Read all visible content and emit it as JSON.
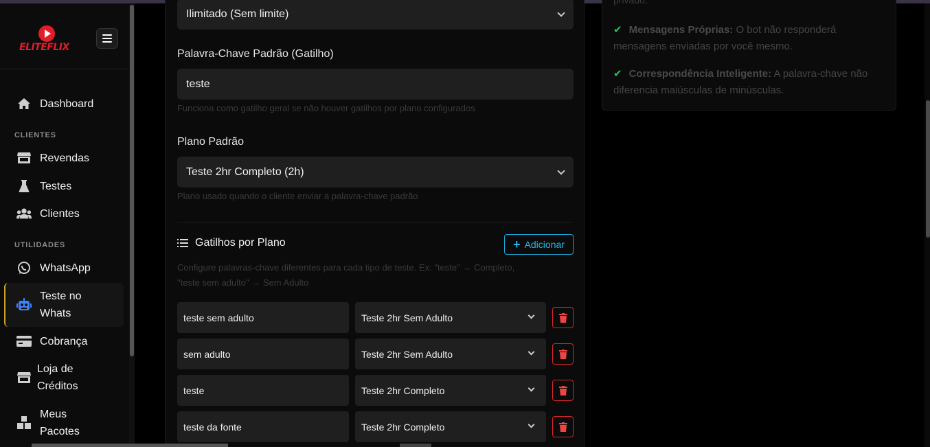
{
  "sidebar": {
    "logo_text": "ELITEFLIX",
    "sections": [
      "CLIENTES",
      "UTILIDADES"
    ],
    "items": [
      {
        "label": "Dashboard",
        "icon": "home-icon"
      },
      {
        "label": "Revendas",
        "icon": "store-icon"
      },
      {
        "label": "Testes",
        "icon": "flask-icon"
      },
      {
        "label": "Clientes",
        "icon": "users-icon"
      },
      {
        "label": "WhatsApp",
        "icon": "whatsapp-icon"
      },
      {
        "label": "Teste no Whats",
        "icon": "robot-icon",
        "active": true
      },
      {
        "label": "Cobrança",
        "icon": "credit-card-icon"
      },
      {
        "label": "Loja de Créditos",
        "icon": "store-icon"
      },
      {
        "label": "Meus Pacotes",
        "icon": "boxes-icon"
      }
    ]
  },
  "form": {
    "limit_value": "Ilimitado (Sem limite)",
    "keyword_label": "Palavra-Chave Padrão (Gatilho)",
    "keyword_value": "teste",
    "keyword_help": "Funciona como gatilho geral se não houver gatilhos por plano configurados",
    "plan_label": "Plano Padrão",
    "plan_value": "Teste 2hr Completo (2h)",
    "plan_help": "Plano usado quando o cliente enviar a palavra-chave padrão"
  },
  "triggers": {
    "title": "Gatilhos por Plano",
    "add_label": "Adicionar",
    "help_line1": "Configure palavras-chave diferentes para cada tipo de teste. Ex: \"teste\" → Completo,",
    "help_line2": "\"teste sem adulto\" → Sem Adulto",
    "rows": [
      {
        "keyword": "teste sem adulto",
        "plan": "Teste 2hr Sem Adulto"
      },
      {
        "keyword": "sem adulto",
        "plan": "Teste 2hr Sem Adulto"
      },
      {
        "keyword": "teste",
        "plan": "Teste 2hr Completo"
      },
      {
        "keyword": "teste da fonte",
        "plan": "Teste 2hr Completo"
      }
    ]
  },
  "info_card": {
    "top_fragment": "privado.",
    "tips": [
      {
        "title": "Mensagens Próprias:",
        "text": "O bot não responderá mensagens enviadas por você mesmo."
      },
      {
        "title": "Correspondência Inteligente:",
        "text": "A palavra-chave não diferencia maiúsculas de minúsculas."
      }
    ]
  },
  "colors": {
    "accent": "#22b7e8",
    "danger": "#dc2626",
    "success": "#22c55e",
    "brand": "#e11d2a",
    "active_border": "#c9a227"
  }
}
